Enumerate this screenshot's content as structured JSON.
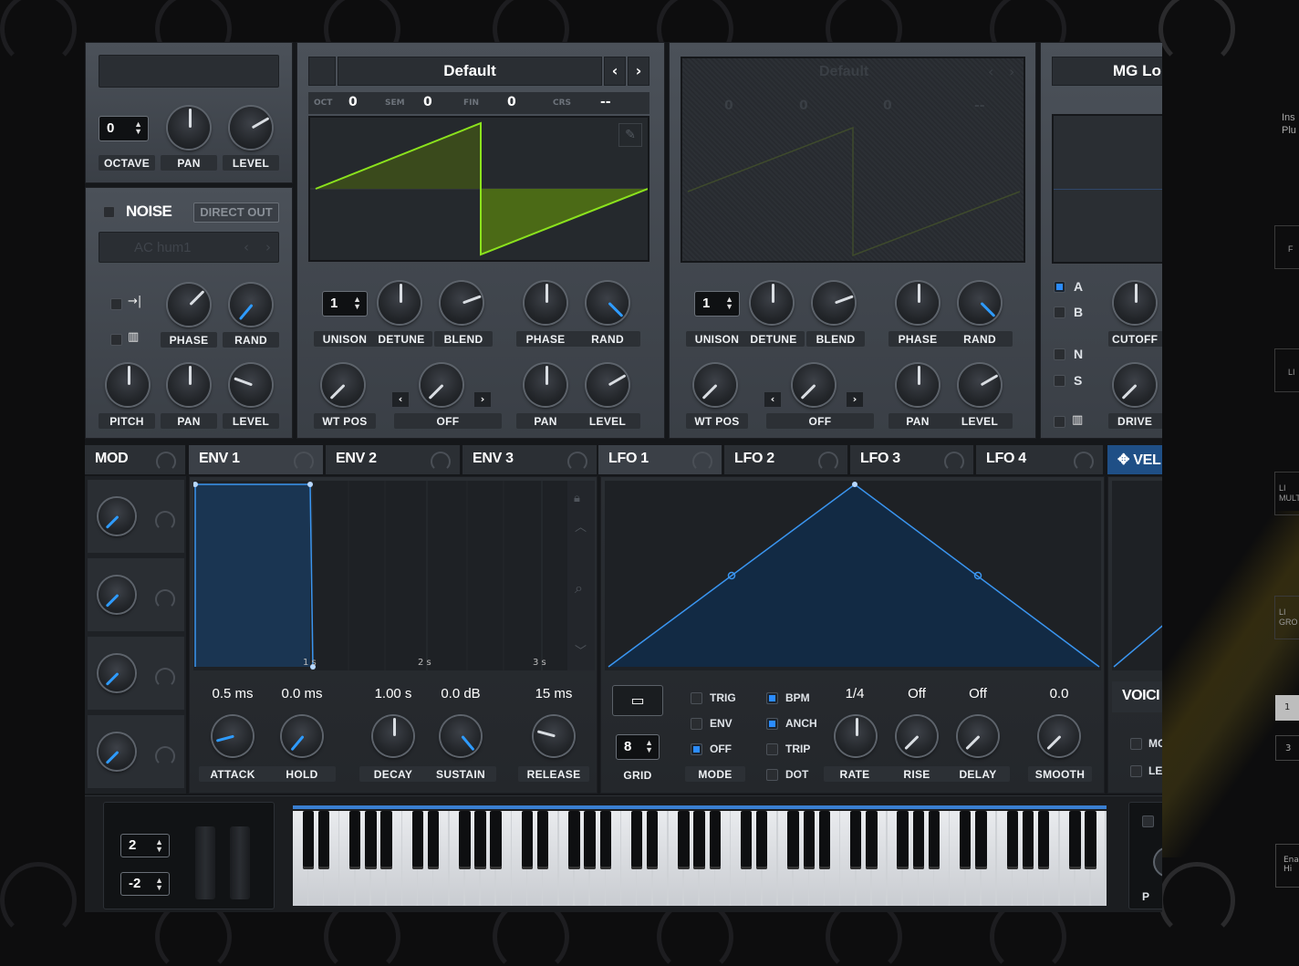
{
  "osc_prev": {
    "octave_value": "0",
    "labels": {
      "octave": "OCTAVE",
      "pan": "PAN",
      "level": "LEVEL"
    }
  },
  "noise": {
    "title": "NOISE",
    "direct_out": "DIRECT OUT",
    "sample": "AC hum1",
    "labels": {
      "phase": "PHASE",
      "rand": "RAND",
      "pitch": "PITCH",
      "pan": "PAN",
      "level": "LEVEL"
    }
  },
  "osc_a": {
    "preset": "Default",
    "oct": "OCT",
    "oct_val": "0",
    "sem": "SEM",
    "sem_val": "0",
    "fin": "FIN",
    "fin_val": "0",
    "crs": "CRS",
    "crs_val": "--",
    "unison": "1",
    "warp_mode": "OFF",
    "labels": {
      "unison": "UNISON",
      "detune": "DETUNE",
      "blend": "BLEND",
      "phase": "PHASE",
      "rand": "RAND",
      "wt_pos": "WT POS",
      "pan": "PAN",
      "level": "LEVEL"
    }
  },
  "osc_b": {
    "preset": "Default",
    "oct_val": "0",
    "sem_val": "0",
    "fin_val": "0",
    "crs_val": "--",
    "unison": "1",
    "warp_mode": "OFF",
    "labels": {
      "unison": "UNISON",
      "detune": "DETUNE",
      "blend": "BLEND",
      "phase": "PHASE",
      "rand": "RAND",
      "wt_pos": "WT POS",
      "pan": "PAN",
      "level": "LEVEL"
    }
  },
  "filter": {
    "preset": "MG Lo",
    "routes": [
      "A",
      "B",
      "N",
      "S"
    ],
    "cutoff": "CUTOFF",
    "drive": "DRIVE"
  },
  "mod_tabs": {
    "mod": "MOD",
    "env1": "ENV 1",
    "env2": "ENV 2",
    "env3": "ENV 3",
    "lfo1": "LFO 1",
    "lfo2": "LFO 2",
    "lfo3": "LFO 3",
    "lfo4": "LFO 4",
    "vel": "VEL"
  },
  "env": {
    "time_marks": [
      "1 s",
      "2 s",
      "3 s"
    ],
    "params": [
      {
        "value": "0.5 ms",
        "label": "ATTACK"
      },
      {
        "value": "0.0 ms",
        "label": "HOLD"
      },
      {
        "value": "1.00 s",
        "label": "DECAY"
      },
      {
        "value": "0.0 dB",
        "label": "SUSTAIN"
      },
      {
        "value": "15 ms",
        "label": "RELEASE"
      }
    ]
  },
  "lfo": {
    "grid_value": "8",
    "grid_label": "GRID",
    "mode_label": "MODE",
    "modes": [
      {
        "label": "TRIG",
        "on": false
      },
      {
        "label": "ENV",
        "on": false
      },
      {
        "label": "OFF",
        "on": true
      }
    ],
    "flags": [
      {
        "label": "BPM",
        "on": true
      },
      {
        "label": "ANCH",
        "on": true
      },
      {
        "label": "TRIP",
        "on": false
      },
      {
        "label": "DOT",
        "on": false
      }
    ],
    "params": [
      {
        "value": "1/4",
        "label": "RATE"
      },
      {
        "value": "Off",
        "label": "RISE"
      },
      {
        "value": "Off",
        "label": "DELAY"
      },
      {
        "value": "0.0",
        "label": "SMOOTH"
      }
    ]
  },
  "voicing": {
    "title": "VOICI",
    "mo": "MO",
    "le": "LEG",
    "po": "P"
  },
  "keyboard": {
    "pitch_up": "2",
    "pitch_down": "-2"
  },
  "side": {
    "inst": "Ins",
    "plug": "Plu",
    "items": [
      "F",
      "LI",
      "LI\nMULT",
      "LI\nGRO"
    ],
    "num1": "1",
    "num2": "3",
    "enable": "Ena\nHi"
  }
}
